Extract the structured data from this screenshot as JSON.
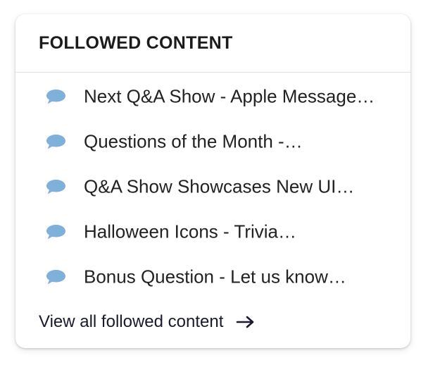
{
  "card": {
    "title": "FOLLOWED CONTENT",
    "items": [
      {
        "label": "Next Q&A Show - Apple Message…",
        "icon": "chat-bubble-icon"
      },
      {
        "label": "Questions of the Month -…",
        "icon": "chat-bubble-icon"
      },
      {
        "label": "Q&A Show Showcases New UI…",
        "icon": "chat-bubble-icon"
      },
      {
        "label": "Halloween Icons - Trivia…",
        "icon": "chat-bubble-icon"
      },
      {
        "label": "Bonus Question - Let us know…",
        "icon": "chat-bubble-icon"
      }
    ],
    "footer_link": "View all followed content",
    "footer_icon": "arrow-right-icon"
  },
  "colors": {
    "icon": "#7eb0d9",
    "text": "#222222",
    "divider": "#e2e2e2"
  }
}
